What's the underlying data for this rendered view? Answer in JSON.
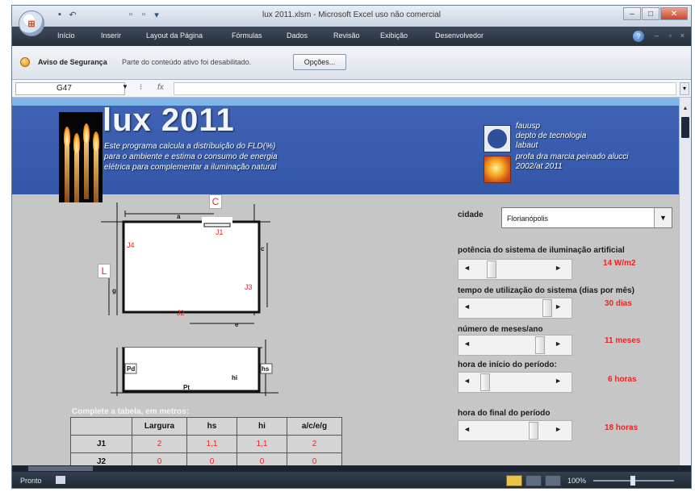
{
  "window": {
    "title": "lux 2011.xlsm - Microsoft Excel uso não comercial",
    "controls": [
      "–",
      "□",
      "✕"
    ]
  },
  "ribbon": {
    "tabs": [
      "Início",
      "Inserir",
      "Layout da Página",
      "Fórmulas",
      "Dados",
      "Revisão",
      "Exibição",
      "Desenvolvedor"
    ]
  },
  "security_bar": {
    "title": "Aviso de Segurança",
    "message": "Parte do conteúdo ativo foi desabilitado.",
    "options_label": "Opções..."
  },
  "formula_bar": {
    "cell_ref": "G47",
    "fx_label": "fx"
  },
  "header": {
    "title": "lux 2011",
    "description": "Este programa calcula a distribuição do FLD(%) para o ambiente e estima o consumo de energia elétrica para complementar a iluminação natural",
    "credits": [
      "fauusp",
      "depto de tecnologia",
      "labaut",
      "profa dra marcia peinado alucci",
      "2002/at 2011"
    ]
  },
  "diagram": {
    "box_letters": [
      "C",
      "L"
    ],
    "plan_labels": [
      "J1",
      "J2",
      "J3",
      "J4"
    ],
    "dim_letters": [
      "a",
      "c",
      "g",
      "e"
    ],
    "section_labels": [
      "Pd",
      "hs",
      "hi",
      "Pt"
    ]
  },
  "table": {
    "caption": "Complete a tabela, em metros:",
    "headers": [
      "",
      "Largura",
      "hs",
      "hi",
      "a/c/e/g"
    ],
    "rows": [
      [
        "J1",
        "2",
        "1,1",
        "1,1",
        "2"
      ],
      [
        "J2",
        "0",
        "0",
        "0",
        "0"
      ]
    ]
  },
  "controls": {
    "city_label": "cidade",
    "city_value": "Florianópolis",
    "power_label": "potência do sistema de iluminação artificial",
    "power_value": "14 W/m2",
    "power_level": 0.2,
    "time_label": "tempo de utilização do sistema (dias por mês)",
    "time_value": "30 dias",
    "time_level": 1.0,
    "months_label": "número de meses/ano",
    "months_value": "11 meses",
    "months_level": 0.9,
    "start_label": "hora de início do período:",
    "start_value": "6 horas",
    "start_level": 0.1,
    "end_label": "hora do final do período",
    "end_value": "18 horas",
    "end_level": 0.8
  },
  "status_bar": {
    "status": "Pronto",
    "zoom": "100%"
  }
}
